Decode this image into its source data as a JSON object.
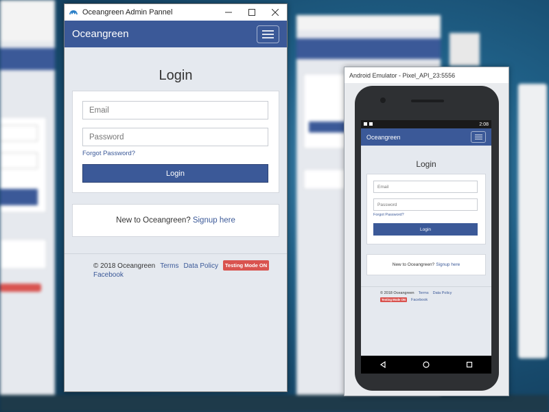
{
  "main_window": {
    "title": "Oceangreen Admin Pannel",
    "brand": "Oceangreen",
    "login_title": "Login",
    "email_placeholder": "Email",
    "password_placeholder": "Password",
    "forgot_password": "Forgot Password?",
    "login_button": "Login",
    "signup_prompt": "New to Oceangreen?",
    "signup_link": "Signup here",
    "footer": {
      "copyright": "© 2018 Oceangreen",
      "terms": "Terms",
      "data_policy": "Data Policy",
      "testing_badge": "Testing Mode ON",
      "facebook": "Facebook"
    },
    "controls": {
      "minimize": "—",
      "maximize": "☐",
      "close": "✕"
    }
  },
  "emulator": {
    "title": "Android Emulator - Pixel_API_23:5556",
    "status_time": "2:08",
    "brand": "Oceangreen",
    "login_title": "Login",
    "email_placeholder": "Email",
    "password_placeholder": "Password",
    "forgot_password": "Forgot Password?",
    "login_button": "Login",
    "signup_prompt": "New to Oceangreen?",
    "signup_link": "Signup here",
    "footer": {
      "copyright": "© 2018 Oceangreen",
      "terms": "Terms",
      "data_policy": "Data Policy",
      "testing_badge": "Testing Mode ON",
      "facebook": "Facebook"
    }
  },
  "colors": {
    "brand_blue": "#3b5998",
    "badge_red": "#d9534f",
    "page_bg": "#e5e9ef"
  },
  "icons": [
    "app-logo-icon",
    "minimize-icon",
    "maximize-icon",
    "close-icon",
    "hamburger-menu-icon",
    "android-back-icon",
    "android-home-icon",
    "android-recents-icon"
  ]
}
